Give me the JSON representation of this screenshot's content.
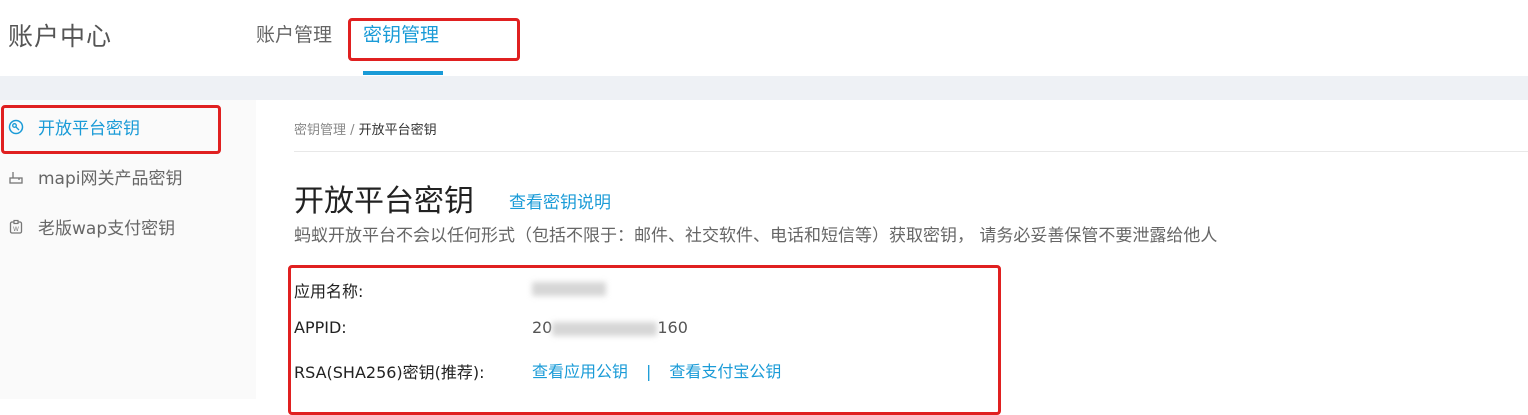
{
  "header": {
    "brand": "账户中心",
    "tabs": [
      {
        "label": "账户管理"
      },
      {
        "label": "密钥管理"
      }
    ]
  },
  "sidebar": {
    "items": [
      {
        "label": "开放平台密钥",
        "icon": "key-icon"
      },
      {
        "label": "mapi网关产品密钥",
        "icon": "gateway-icon"
      },
      {
        "label": "老版wap支付密钥",
        "icon": "wap-icon"
      }
    ]
  },
  "main": {
    "breadcrumb": {
      "parent": "密钥管理",
      "sep": " / ",
      "current": "开放平台密钥"
    },
    "title": "开放平台密钥",
    "title_link": "查看密钥说明",
    "description": "蚂蚁开放平台不会以任何形式（包括不限于：邮件、社交软件、电话和短信等）获取密钥， 请务必妥善保管不要泄露给他人",
    "fields": {
      "app_name_label": "应用名称:",
      "appid_label": "APPID:",
      "appid_prefix": "20",
      "appid_suffix": "160",
      "rsa_label": "RSA(SHA256)密钥(推荐):",
      "rsa_link_app": "查看应用公钥",
      "rsa_separator": "|",
      "rsa_link_alipay": "查看支付宝公钥"
    }
  },
  "colors": {
    "accent": "#1a9bd7",
    "highlight_box": "#e02020"
  }
}
